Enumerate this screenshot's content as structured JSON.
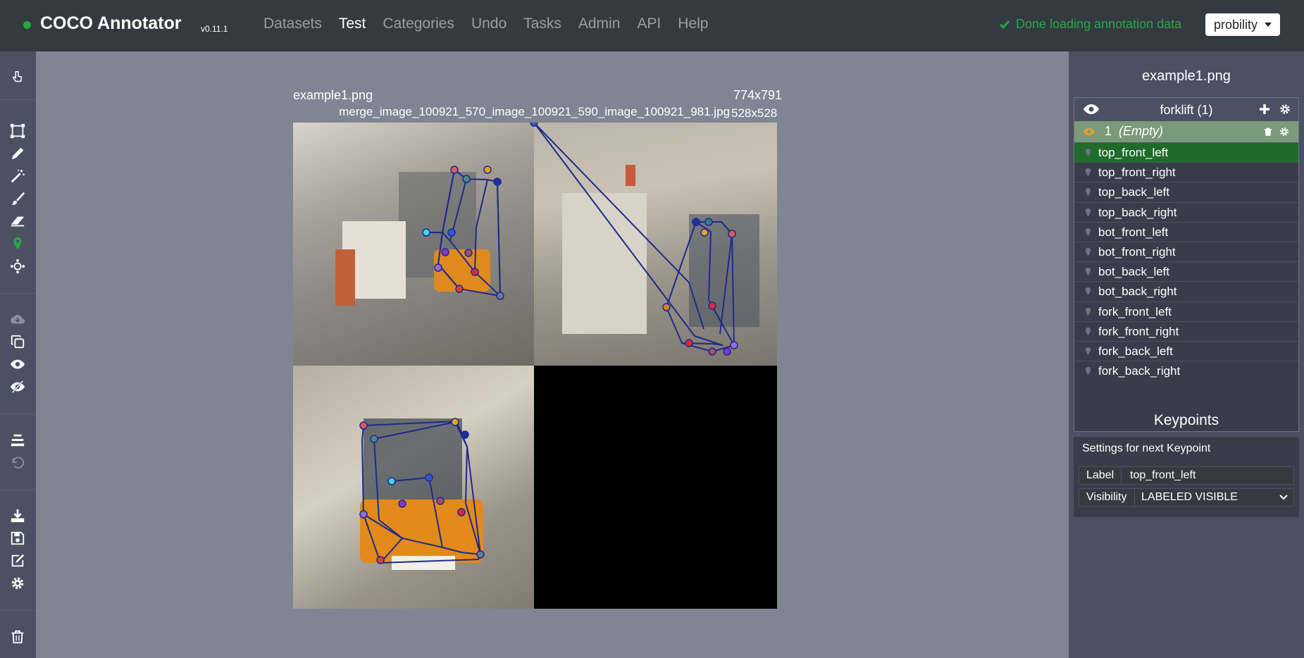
{
  "navbar": {
    "brand": "COCO Annotator",
    "version": "v0.11.1",
    "items": [
      {
        "label": "Datasets",
        "active": false
      },
      {
        "label": "Test",
        "active": true
      },
      {
        "label": "Categories",
        "active": false
      },
      {
        "label": "Undo",
        "active": false
      },
      {
        "label": "Tasks",
        "active": false
      },
      {
        "label": "Admin",
        "active": false
      },
      {
        "label": "API",
        "active": false
      },
      {
        "label": "Help",
        "active": false
      }
    ],
    "status": "Done loading annotation data",
    "user": "probility"
  },
  "toolbar": {
    "tools": [
      "pointer-icon",
      "bbox-icon",
      "polygon-pencil-icon",
      "magic-wand-icon",
      "brush-icon",
      "eraser-icon",
      "keypoint-icon",
      "dextr-icon",
      "download-cloud-icon",
      "copy-icon",
      "show-all-icon",
      "hide-all-icon",
      "align-icon",
      "undo-icon",
      "export-icon",
      "save-icon",
      "edit-icon",
      "settings-icon",
      "delete-icon"
    ]
  },
  "canvas": {
    "filename": "example1.png",
    "dimensions": "774x791",
    "subfile": "merge_image_100921_570_image_100921_590_image_100921_981.jpg",
    "subdimensions": "528x528"
  },
  "panel": {
    "title": "example1.png",
    "category": "forklift (1)",
    "annotation_id": "1",
    "annotation_label": "(Empty)",
    "keypoints": [
      "top_front_left",
      "top_front_right",
      "top_back_left",
      "top_back_right",
      "bot_front_left",
      "bot_front_right",
      "bot_back_left",
      "bot_back_right",
      "fork_front_left",
      "fork_front_right",
      "fork_back_left",
      "fork_back_right"
    ],
    "selected_keypoint": "top_front_left",
    "keypoints_title": "Keypoints",
    "settings_title": "Settings for next Keypoint",
    "label_field": "Label",
    "label_value": "top_front_left",
    "visibility_field": "Visibility",
    "visibility_value": "LABELED VISIBLE"
  },
  "colors": {
    "navbar": "#343a40",
    "toolbar": "#4b5162",
    "canvas": "#7f8592",
    "success": "#28a745",
    "selected_row": "#1f6b2a"
  }
}
